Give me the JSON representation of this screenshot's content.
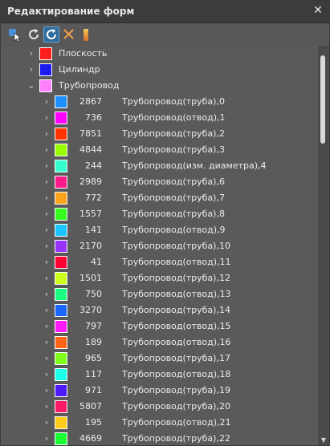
{
  "window": {
    "title": "Редактирование форм",
    "close_glyph": "✕"
  },
  "toolbar": {
    "buttons": [
      {
        "icon": "select-cursor-icon"
      },
      {
        "icon": "refresh-icon"
      },
      {
        "icon": "refresh-active-icon",
        "active": true
      },
      {
        "icon": "delete-x-icon"
      },
      {
        "icon": "color-gradient-icon"
      }
    ]
  },
  "tree": {
    "top_items": [
      {
        "label": "Плоскость",
        "color": "#ff1e1e",
        "expanded": false
      },
      {
        "label": "Цилиндр",
        "color": "#1c1cf0",
        "expanded": false
      },
      {
        "label": "Трубопровод",
        "color": "#ff80ff",
        "expanded": true
      }
    ],
    "children": [
      {
        "num": "2867",
        "label": "Трубопровод(труба),0",
        "color": "#1e90ff"
      },
      {
        "num": "736",
        "label": "Трубопровод(отвод),1",
        "color": "#ff00ff"
      },
      {
        "num": "7851",
        "label": "Трубопровод(труба),2",
        "color": "#ff3300"
      },
      {
        "num": "4844",
        "label": "Трубопровод(труба),3",
        "color": "#99ff00"
      },
      {
        "num": "244",
        "label": "Трубопровод(изм. диаметра),4",
        "color": "#33ffcc"
      },
      {
        "num": "2989",
        "label": "Трубопровод(труба),6",
        "color": "#ff1a8c"
      },
      {
        "num": "772",
        "label": "Трубопровод(труба),7",
        "color": "#ffa31a"
      },
      {
        "num": "1557",
        "label": "Трубопровод(труба),8",
        "color": "#33ff1a"
      },
      {
        "num": "141",
        "label": "Трубопровод(отвод),9",
        "color": "#1ac6ff"
      },
      {
        "num": "2170",
        "label": "Трубопровод(труба),10",
        "color": "#9933ff"
      },
      {
        "num": "41",
        "label": "Трубопровод(отвод),11",
        "color": "#ff0033"
      },
      {
        "num": "1501",
        "label": "Трубопровод(труба),12",
        "color": "#ccff1a"
      },
      {
        "num": "750",
        "label": "Трубопровод(отвод),13",
        "color": "#1aff80"
      },
      {
        "num": "3270",
        "label": "Трубопровод(труба),14",
        "color": "#1a66ff"
      },
      {
        "num": "797",
        "label": "Трубопровод(отвод),15",
        "color": "#ff1aff"
      },
      {
        "num": "189",
        "label": "Трубопровод(отвод),16",
        "color": "#ff661a"
      },
      {
        "num": "965",
        "label": "Трубопровод(труба),17",
        "color": "#80ff1a"
      },
      {
        "num": "117",
        "label": "Трубопровод(отвод),18",
        "color": "#1affe6"
      },
      {
        "num": "971",
        "label": "Трубопровод(труба),19",
        "color": "#4d1aff"
      },
      {
        "num": "5807",
        "label": "Трубопровод(труба),20",
        "color": "#ff1a66"
      },
      {
        "num": "195",
        "label": "Трубопровод(отвод),21",
        "color": "#ffcc1a"
      },
      {
        "num": "4669",
        "label": "Трубопровод(труба),22",
        "color": "#1aff33"
      }
    ]
  }
}
